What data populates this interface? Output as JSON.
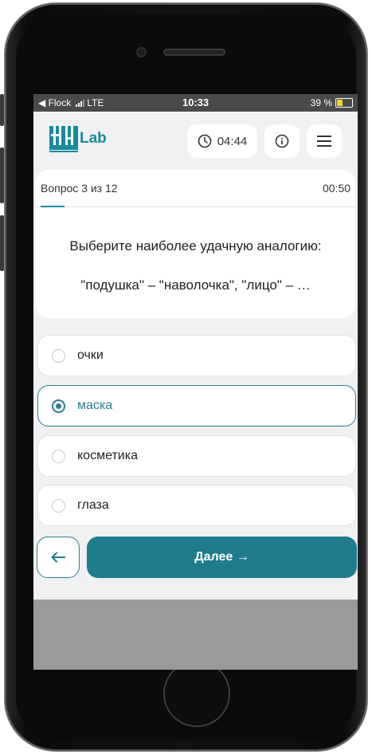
{
  "status": {
    "carrier_back": "◀ Flock",
    "network": "LTE",
    "time": "10:33",
    "battery": "39 %",
    "battery_color": "#f5d020"
  },
  "header": {
    "logo_text": "Lab",
    "timer": "04:44",
    "timer_icon": "clock-icon",
    "info_icon": "info-icon",
    "menu_icon": "hamburger-menu-icon"
  },
  "question": {
    "counter": "Вопрос 3 из 12",
    "time_left": "00:50",
    "prompt": "Выберите наиболее удачную аналогию:",
    "body": "\"подушка\" – \"наволочка\", \"лицо\" – …"
  },
  "options": [
    {
      "label": "очки",
      "selected": false
    },
    {
      "label": "маска",
      "selected": true
    },
    {
      "label": "косметика",
      "selected": false
    },
    {
      "label": "глаза",
      "selected": false
    }
  ],
  "actions": {
    "back_icon": "arrow-left-icon",
    "next_label": "Далее →"
  },
  "colors": {
    "accent": "#1e7c8c",
    "background": "#f0f1f3"
  }
}
